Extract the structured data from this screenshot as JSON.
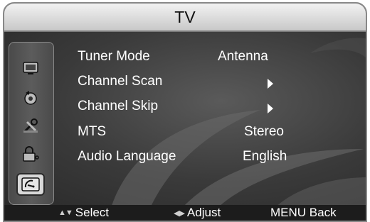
{
  "header": {
    "title": "TV"
  },
  "sidebar": {
    "icons": [
      {
        "name": "picture-icon",
        "selected": false
      },
      {
        "name": "sound-icon",
        "selected": false
      },
      {
        "name": "setup-icon",
        "selected": false
      },
      {
        "name": "lock-icon",
        "selected": false
      },
      {
        "name": "tv-antenna-icon",
        "selected": true
      }
    ]
  },
  "menu": {
    "items": [
      {
        "label": "Tuner Mode",
        "value": "Antenna",
        "type": "value"
      },
      {
        "label": "Channel  Scan",
        "value": "",
        "type": "submenu"
      },
      {
        "label": "Channel  Skip",
        "value": "",
        "type": "submenu"
      },
      {
        "label": "MTS",
        "value": "Stereo",
        "type": "value"
      },
      {
        "label": "Audio  Language",
        "value": "English",
        "type": "value"
      }
    ]
  },
  "footer": {
    "select_label": "Select",
    "adjust_label": "Adjust",
    "back_label": "MENU Back"
  }
}
